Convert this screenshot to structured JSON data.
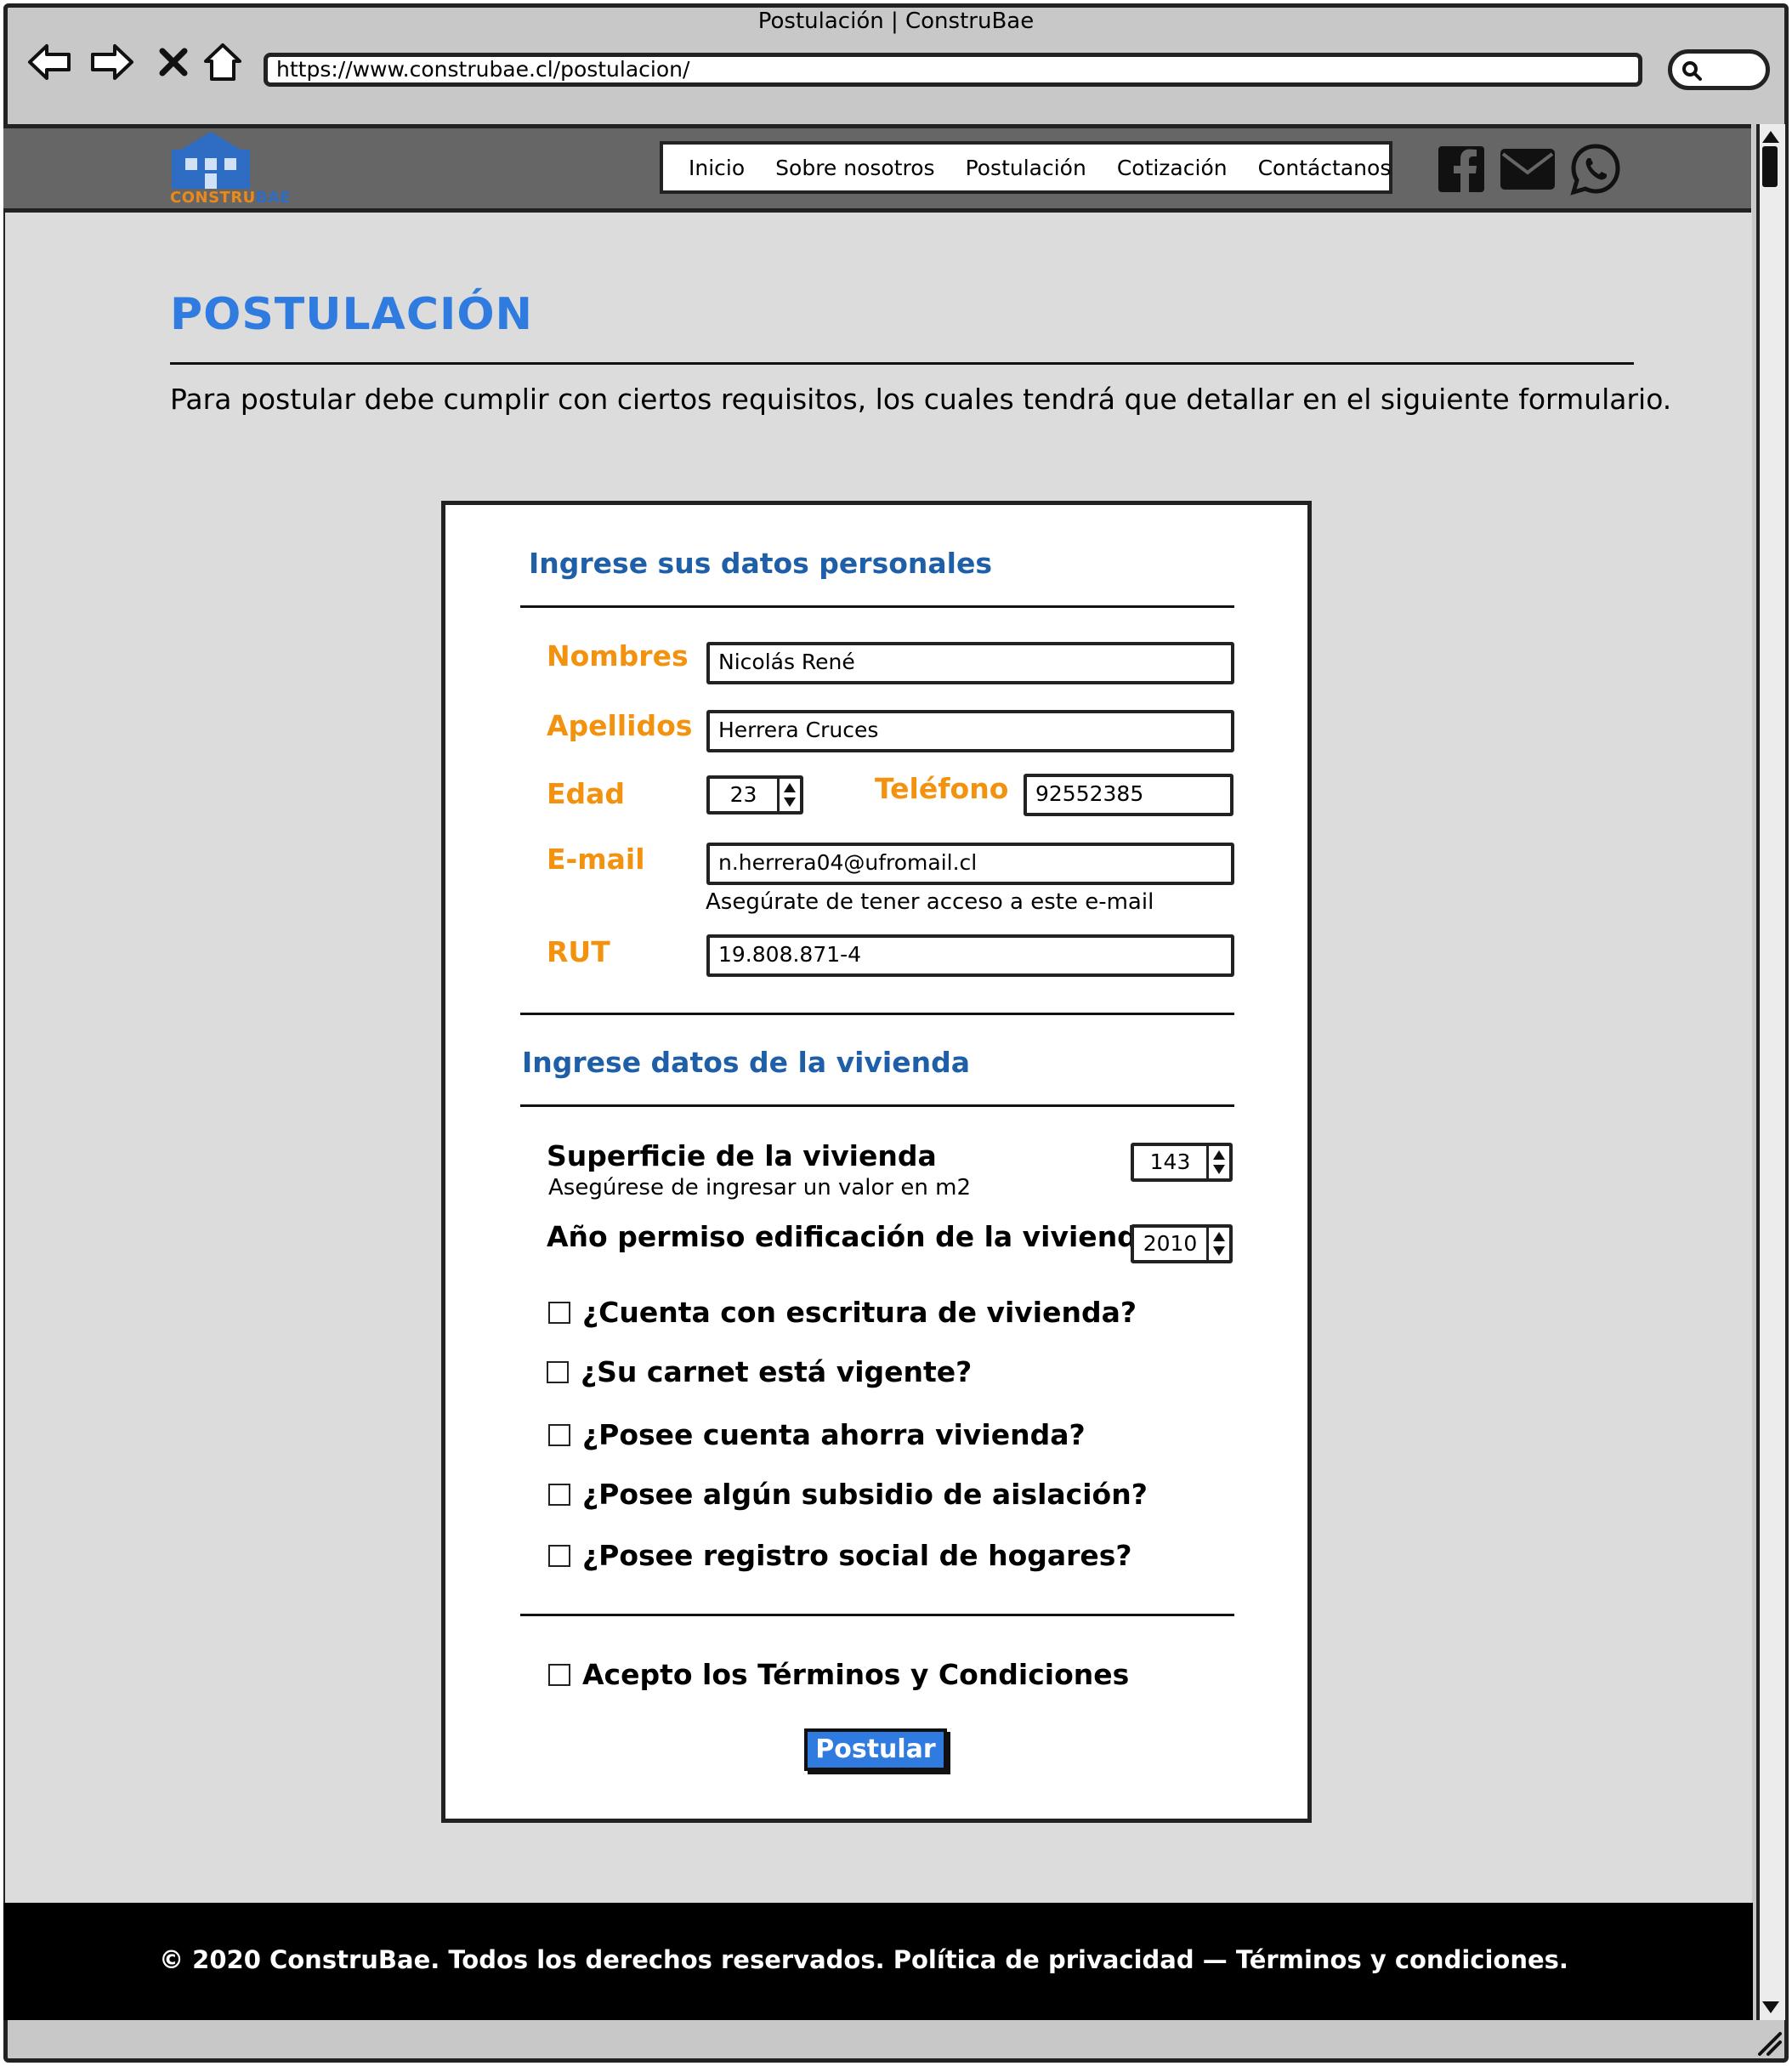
{
  "browser": {
    "window_title": "Postulación | ConstruBae",
    "url": "https://www.construbae.cl/postulacion/"
  },
  "header": {
    "logo_text_a": "CONSTRU",
    "logo_text_b": "BAE",
    "nav": [
      "Inicio",
      "Sobre nosotros",
      "Postulación",
      "Cotización",
      "Contáctanos"
    ],
    "social_icons": [
      "facebook-icon",
      "mail-icon",
      "whatsapp-icon"
    ]
  },
  "page": {
    "title": "POSTULACIÓN",
    "intro": "Para postular debe cumplir con ciertos requisitos, los cuales tendrá que detallar en el siguiente formulario."
  },
  "form": {
    "personal": {
      "title": "Ingrese sus datos personales",
      "nombres_label": "Nombres",
      "nombres_value": "Nicolás René",
      "apellidos_label": "Apellidos",
      "apellidos_value": "Herrera Cruces",
      "edad_label": "Edad",
      "edad_value": "23",
      "telefono_label": "Teléfono",
      "telefono_value": "92552385",
      "email_label": "E-mail",
      "email_value": "n.herrera04@ufromail.cl",
      "email_hint": "Asegúrate de tener acceso a este e-mail",
      "rut_label": "RUT",
      "rut_value": "19.808.871-4"
    },
    "vivienda": {
      "title": "Ingrese datos de la vivienda",
      "superficie_label": "Superficie de la vivienda",
      "superficie_hint": "Asegúrese de ingresar un valor en m2",
      "superficie_value": "143",
      "anio_label": "Año permiso edificación de la vivienda",
      "anio_value": "2010",
      "questions": [
        "¿Cuenta con escritura de vivienda?",
        "¿Su carnet está vigente?",
        "¿Posee cuenta ahorra vivienda?",
        "¿Posee algún subsidio de aislación?",
        "¿Posee registro social de hogares?"
      ]
    },
    "terms_label": "Acepto los Términos y Condiciones",
    "submit_label": "Postular"
  },
  "footer": {
    "text": "© 2020 ConstruBae. Todos los derechos reservados. Política de privacidad — Términos y condiciones."
  },
  "colors": {
    "accent_blue": "#2f7be0",
    "section_blue": "#1e5fa8",
    "label_orange": "#f3920f"
  }
}
